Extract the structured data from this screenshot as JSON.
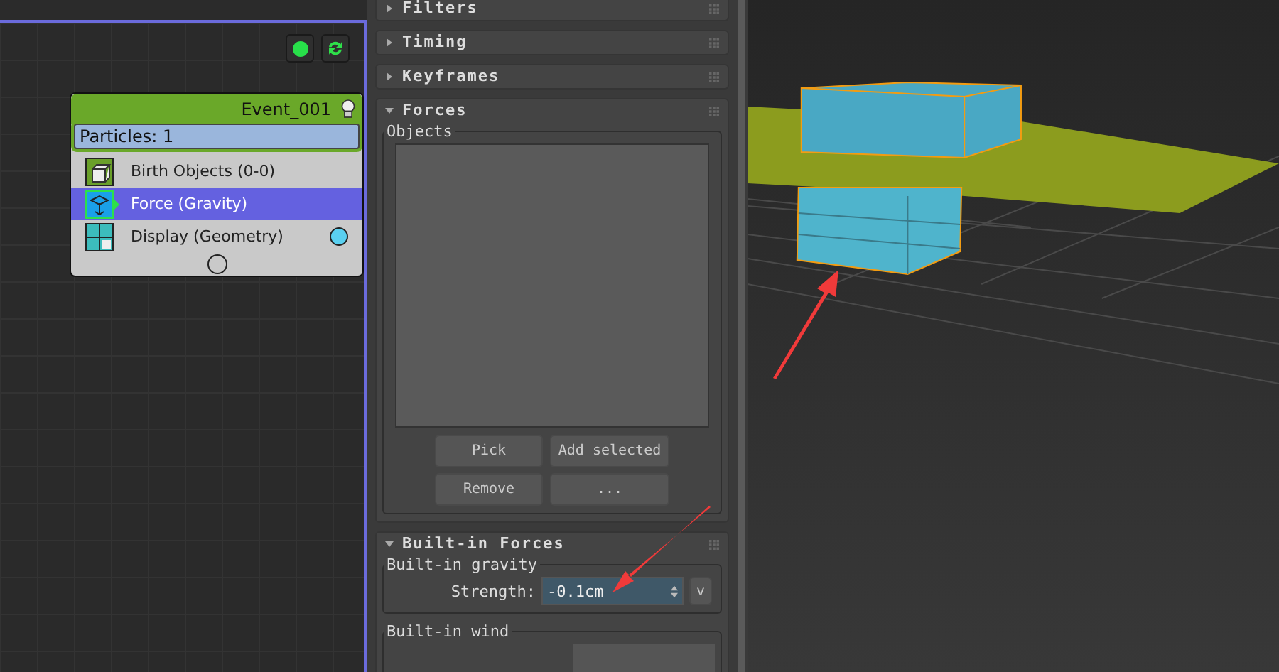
{
  "graph": {
    "event": {
      "title": "Event_001",
      "particles": "Particles: 1",
      "operators": [
        {
          "kind": "birth",
          "label": "Birth Objects (0-0)",
          "selected": false
        },
        {
          "kind": "force",
          "label": "Force (Gravity)",
          "selected": true
        },
        {
          "kind": "display",
          "label": "Display (Geometry)",
          "selected": false
        }
      ]
    }
  },
  "rollouts": [
    {
      "title": "Filters",
      "expanded": false
    },
    {
      "title": "Timing",
      "expanded": false
    },
    {
      "title": "Keyframes",
      "expanded": false
    },
    {
      "kind": "forces",
      "title": "Forces",
      "expanded": true,
      "group": "Objects",
      "buttons": [
        "Pick",
        "Add selected",
        "Remove",
        "..."
      ]
    },
    {
      "kind": "builtin",
      "title": "Built-in Forces",
      "expanded": true,
      "groups": [
        {
          "title": "Built-in gravity",
          "field_label": "Strength:",
          "value": "-0.1cm",
          "button": "v"
        },
        {
          "title": "Built-in wind"
        }
      ]
    }
  ]
}
